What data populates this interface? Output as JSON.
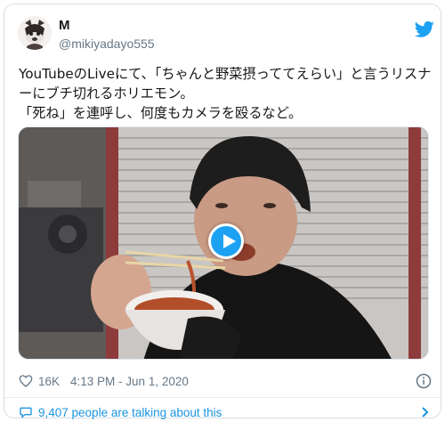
{
  "tweet": {
    "display_name": "M",
    "handle": "@mikiyadayo555",
    "text": "YouTubeのLiveにて、「ちゃんと野菜摂っててえらい」と言うリスナーにブチ切れるホリエモン。\n「死ね」を連呼し、何度もカメラを殴るなど。",
    "like_count": "16K",
    "timestamp": "4:13 PM - Jun 1, 2020",
    "conversation_text": "9,407 people are talking about this"
  },
  "icons": {
    "brand": "twitter-bird-icon",
    "like": "heart-icon",
    "info": "info-icon",
    "conversation": "comment-bubble-icon",
    "expand": "chevron-right-icon",
    "play": "play-icon"
  },
  "colors": {
    "accent": "#1da1f2",
    "link": "#1b95e0",
    "text": "#14171a",
    "secondary": "#657786",
    "border": "#d8dee3"
  }
}
